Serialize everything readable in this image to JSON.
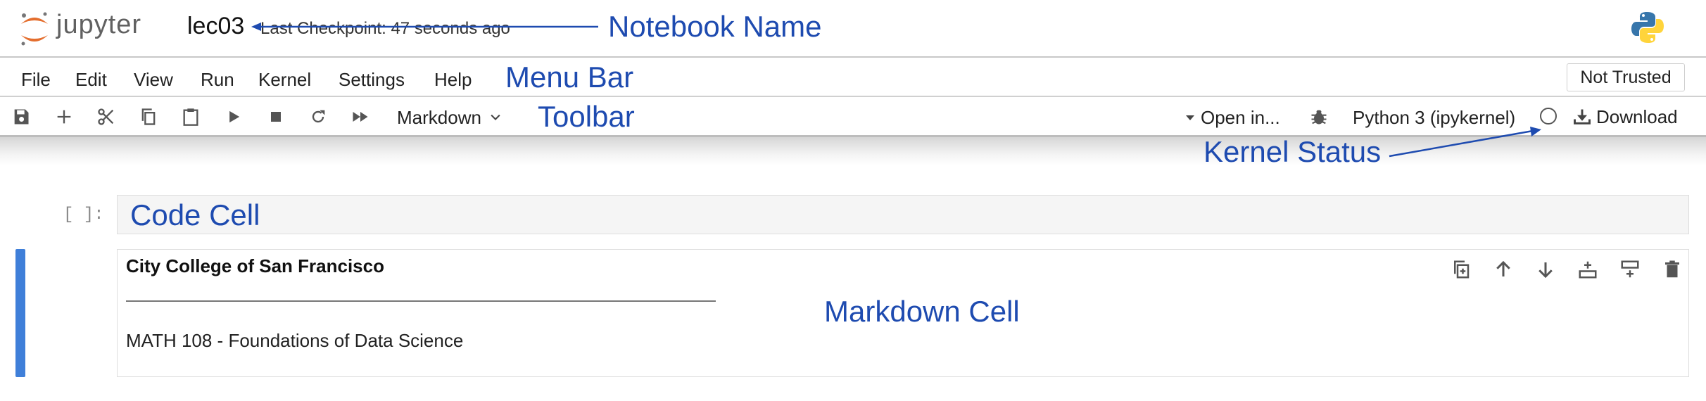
{
  "header": {
    "logo_text": "jupyter",
    "notebook_name": "lec03",
    "checkpoint": "Last Checkpoint: 47 seconds ago"
  },
  "menu": {
    "items": [
      "File",
      "Edit",
      "View",
      "Run",
      "Kernel",
      "Settings",
      "Help"
    ],
    "trust_button": "Not Trusted"
  },
  "toolbar": {
    "cell_type": "Markdown",
    "open_in": "Open in...",
    "kernel_name": "Python 3 (ipykernel)",
    "download": "Download"
  },
  "code_cell": {
    "prompt": "[ ]:",
    "content": "Code Cell"
  },
  "markdown_cell": {
    "title": "City College of San Francisco",
    "subtitle": "MATH 108 - Foundations of Data Science"
  },
  "annotations": {
    "notebook_name": "Notebook Name",
    "menu_bar": "Menu Bar",
    "toolbar": "Toolbar",
    "kernel_status": "Kernel Status",
    "markdown_cell": "Markdown Cell"
  },
  "colors": {
    "annotation": "#1e4bb0",
    "jupyter_orange": "#e46e2e",
    "cell_selected_bar": "#3f7fd9"
  }
}
